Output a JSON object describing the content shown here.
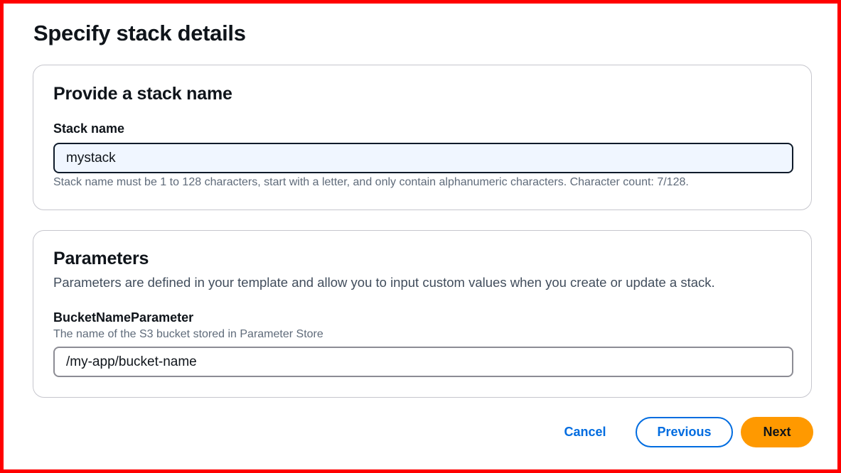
{
  "page": {
    "title": "Specify stack details"
  },
  "stack_name_section": {
    "heading": "Provide a stack name",
    "field_label": "Stack name",
    "value": "mystack",
    "hint": "Stack name must be 1 to 128 characters, start with a letter, and only contain alphanumeric characters. Character count: 7/128."
  },
  "parameters_section": {
    "heading": "Parameters",
    "description": "Parameters are defined in your template and allow you to input custom values when you create or update a stack.",
    "parameters": [
      {
        "name": "BucketNameParameter",
        "description": "The name of the S3 bucket stored in Parameter Store",
        "value": "/my-app/bucket-name"
      }
    ]
  },
  "actions": {
    "cancel_label": "Cancel",
    "previous_label": "Previous",
    "next_label": "Next"
  },
  "colors": {
    "accent_link": "#006ce0",
    "primary_button": "#ff9900",
    "focused_input_bg": "#f0f6ff",
    "frame_border": "#ff0000"
  }
}
